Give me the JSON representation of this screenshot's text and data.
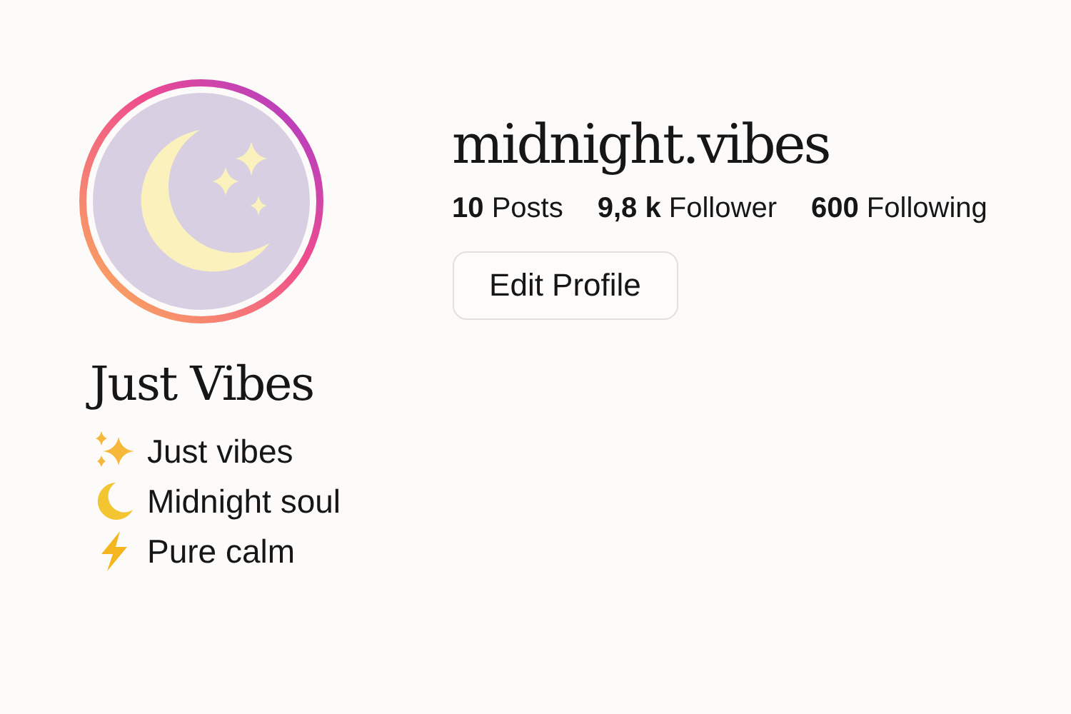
{
  "profile": {
    "display_name": "Just Vibes",
    "username": "midnight.vibes"
  },
  "stats": [
    "**10** Posts",
    "**9,8 k** Follower",
    "**600** Following"
  ],
  "edit_button": "Edit Profile",
  "bio": [
    {
      "kind": "sparkles",
      "text": "Just vibes"
    },
    {
      "kind": "moon",
      "text": "Midnight soul"
    },
    {
      "kind": "bolt",
      "text": "Pure calm"
    }
  ]
}
